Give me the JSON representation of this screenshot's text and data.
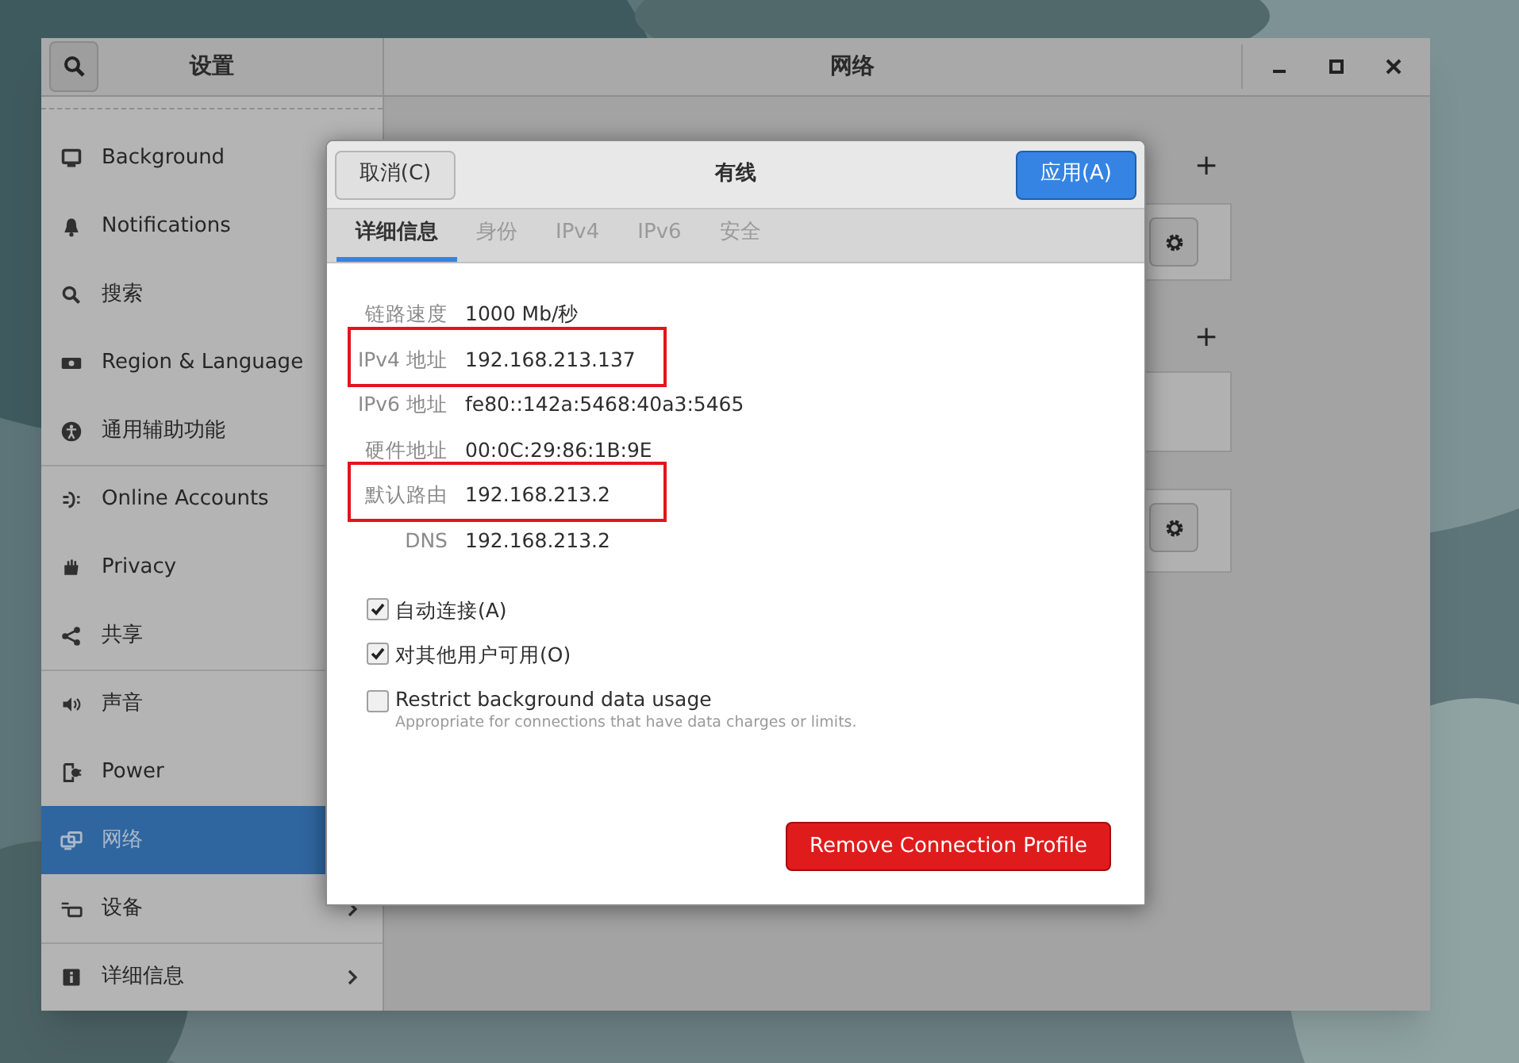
{
  "window": {
    "sidebar_title": "设置",
    "panel_title": "网络"
  },
  "sidebar": {
    "items": [
      {
        "label": "Background",
        "selected": false,
        "divider_above": false,
        "has_arrow": false
      },
      {
        "label": "Notifications",
        "selected": false,
        "divider_above": false,
        "has_arrow": false
      },
      {
        "label": "搜索",
        "selected": false,
        "divider_above": false,
        "has_arrow": false
      },
      {
        "label": "Region & Language",
        "selected": false,
        "divider_above": false,
        "has_arrow": false
      },
      {
        "label": "通用辅助功能",
        "selected": false,
        "divider_above": false,
        "has_arrow": false
      },
      {
        "label": "Online Accounts",
        "selected": false,
        "divider_above": true,
        "has_arrow": false
      },
      {
        "label": "Privacy",
        "selected": false,
        "divider_above": false,
        "has_arrow": false
      },
      {
        "label": "共享",
        "selected": false,
        "divider_above": false,
        "has_arrow": false
      },
      {
        "label": "声音",
        "selected": false,
        "divider_above": true,
        "has_arrow": false
      },
      {
        "label": "Power",
        "selected": false,
        "divider_above": false,
        "has_arrow": false
      },
      {
        "label": "网络",
        "selected": true,
        "divider_above": false,
        "has_arrow": false
      },
      {
        "label": "设备",
        "selected": false,
        "divider_above": false,
        "has_arrow": true
      },
      {
        "label": "详细信息",
        "selected": false,
        "divider_above": true,
        "has_arrow": true
      }
    ]
  },
  "panel": {
    "add_buttons": [
      "+",
      "+"
    ]
  },
  "dialog": {
    "title": "有线",
    "cancel_button": "取消(C)",
    "apply_button": "应用(A)",
    "tabs": [
      {
        "label": "详细信息",
        "selected": true
      },
      {
        "label": "身份",
        "selected": false
      },
      {
        "label": "IPv4",
        "selected": false
      },
      {
        "label": "IPv6",
        "selected": false
      },
      {
        "label": "安全",
        "selected": false
      }
    ],
    "details": [
      {
        "label": "链路速度",
        "value": "1000 Mb/秒",
        "highlighted": false
      },
      {
        "label": "IPv4 地址",
        "value": "192.168.213.137",
        "highlighted": true
      },
      {
        "label": "IPv6 地址",
        "value": "fe80::142a:5468:40a3:5465",
        "highlighted": false
      },
      {
        "label": "硬件地址",
        "value": "00:0C:29:86:1B:9E",
        "highlighted": false
      },
      {
        "label": "默认路由",
        "value": "192.168.213.2",
        "highlighted": true
      },
      {
        "label": "DNS",
        "value": "192.168.213.2",
        "highlighted": false
      }
    ],
    "options": [
      {
        "label": "自动连接(A)",
        "checked": true
      },
      {
        "label": "对其他用户可用(O)",
        "checked": true
      },
      {
        "label": "Restrict background data usage",
        "description": "Appropriate for connections that have data charges or limits.",
        "checked": false
      }
    ],
    "remove_button": "Remove Connection Profile"
  }
}
